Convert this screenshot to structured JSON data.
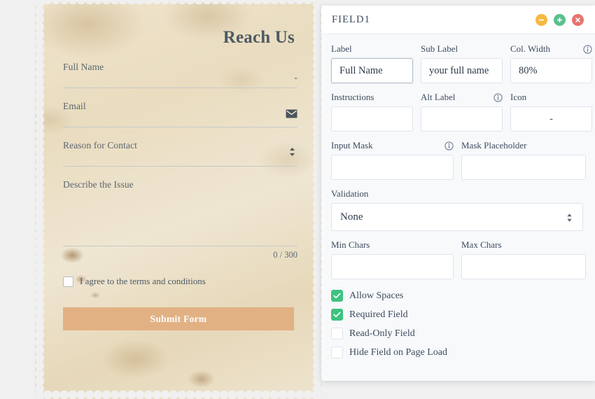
{
  "page": {
    "background_color": "#f0f0f0"
  },
  "paper_form": {
    "title": "Reach Us",
    "paper_color": "#e9dcc0",
    "fields": [
      {
        "label": "Full Name",
        "affix_icon": "dash-icon",
        "type": "line"
      },
      {
        "label": "Email",
        "affix_icon": "mail-icon",
        "type": "line"
      },
      {
        "label": "Reason for Contact",
        "affix_icon": "stepper-icon",
        "type": "line"
      },
      {
        "label": "Describe the Issue",
        "affix_icon": "",
        "type": "textarea"
      }
    ],
    "counter": "0 / 300",
    "consent_label": "I agree to the terms and conditions",
    "consent_checked": false,
    "submit_label": "Submit Form",
    "submit_color": "#e2b183"
  },
  "settings_panel": {
    "title": "FIELD1",
    "actions": [
      {
        "name": "collapse-button",
        "icon": "minus-icon",
        "color": "#f5b942"
      },
      {
        "name": "add-button",
        "icon": "plus-icon",
        "color": "#5cc08e"
      },
      {
        "name": "close-button",
        "icon": "close-icon",
        "color": "#e8736f"
      }
    ],
    "fields": {
      "label": {
        "label": "Label",
        "value": "Full Name",
        "placeholder": "",
        "focused": true
      },
      "sub_label": {
        "label": "Sub Label",
        "value": "your full name",
        "placeholder": ""
      },
      "col_width": {
        "label": "Col. Width",
        "value": "80%",
        "placeholder": "",
        "has_info": true
      },
      "instructions": {
        "label": "Instructions",
        "value": "",
        "placeholder": ""
      },
      "alt_label": {
        "label": "Alt Label",
        "value": "",
        "placeholder": "",
        "has_info": true
      },
      "icon": {
        "label": "Icon",
        "value": "-",
        "placeholder": ""
      },
      "input_mask": {
        "label": "Input Mask",
        "value": "",
        "placeholder": "",
        "has_info": true
      },
      "mask_placeholder": {
        "label": "Mask Placeholder",
        "value": "",
        "placeholder": ""
      },
      "validation": {
        "label": "Validation",
        "value": "None"
      },
      "min_chars": {
        "label": "Min Chars",
        "value": "",
        "placeholder": ""
      },
      "max_chars": {
        "label": "Max Chars",
        "value": "",
        "placeholder": ""
      }
    },
    "checkboxes": [
      {
        "label": "Allow Spaces",
        "checked": true
      },
      {
        "label": "Required Field",
        "checked": true
      },
      {
        "label": "Read-Only Field",
        "checked": false
      },
      {
        "label": "Hide Field on Page Load",
        "checked": false
      }
    ],
    "checkbox_on_color": "#3fc380"
  }
}
